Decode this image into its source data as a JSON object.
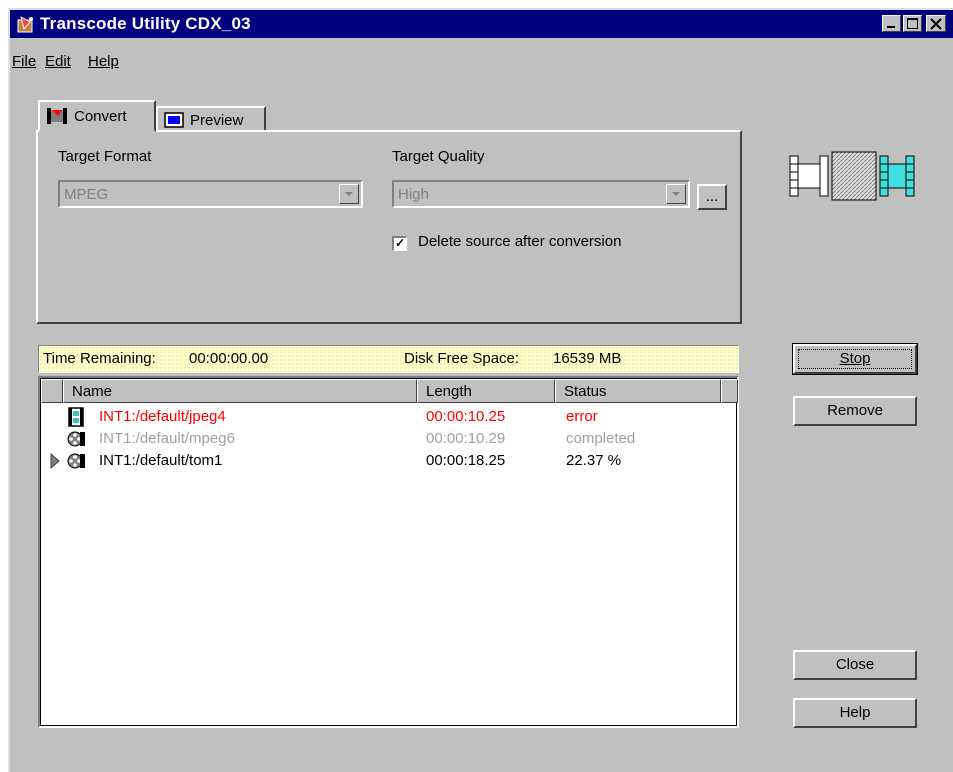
{
  "window": {
    "title": "Transcode Utility  CDX_03"
  },
  "menu": {
    "file": "File",
    "edit": "Edit",
    "help": "Help"
  },
  "tabs": [
    {
      "label": "Convert",
      "selected": true
    },
    {
      "label": "Preview",
      "selected": false
    }
  ],
  "convert": {
    "target_format_label": "Target Format",
    "target_format_value": "MPEG",
    "target_quality_label": "Target Quality",
    "target_quality_value": "High",
    "browse_label": "...",
    "delete_source_label": "Delete source after conversion",
    "delete_source_checked": true,
    "checkmark": "✓"
  },
  "status": {
    "time_remaining_label": "Time Remaining:",
    "time_remaining_value": "00:00:00.00",
    "disk_free_label": "Disk Free Space:",
    "disk_free_value": "16539 MB"
  },
  "list": {
    "columns": [
      "Name",
      "Length",
      "Status"
    ],
    "rows": [
      {
        "name": "INT1:/default/jpeg4",
        "length": "00:00:10.25",
        "status": "error",
        "color": "#ff0000",
        "icon": "film-strip-icon"
      },
      {
        "name": "INT1:/default/mpeg6",
        "length": "00:00:10.29",
        "status": "completed",
        "color": "#a0a0a0",
        "icon": "film-reel-icon"
      },
      {
        "name": "INT1:/default/tom1",
        "length": "00:00:18.25",
        "status": "22.37 %",
        "color": "#000000",
        "icon": "film-reel-icon",
        "current": true
      }
    ]
  },
  "buttons": {
    "stop": "Stop",
    "remove": "Remove",
    "close": "Close",
    "help": "Help"
  },
  "colors": {
    "titlebar": "#000080",
    "error": "#ff0000",
    "completed": "#a0a0a0",
    "status_bg": "#ffffcc",
    "accent": "#40e0e0"
  }
}
